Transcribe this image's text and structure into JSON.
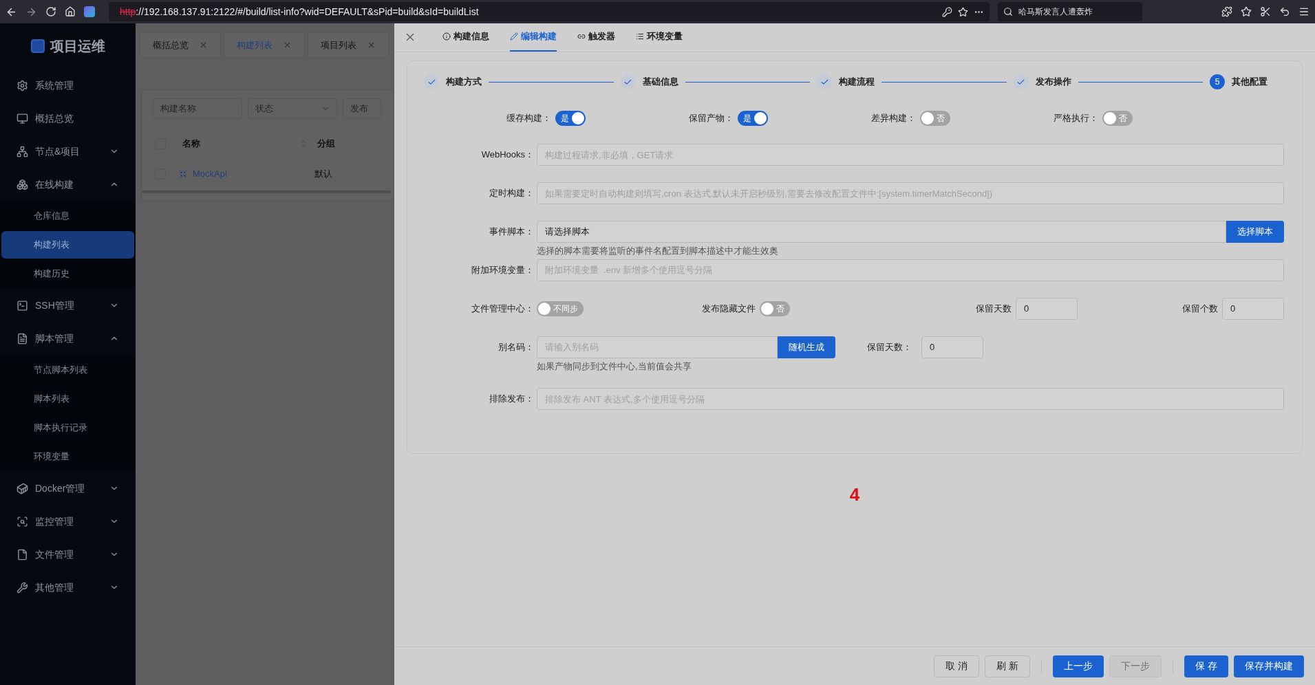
{
  "browser": {
    "url_scheme": "http",
    "url_rest": "://192.168.137.91:2122/#/build/list-info?wid=DEFAULT&sPid=build&sId=buildList",
    "search": "哈马斯发言人遭轰炸"
  },
  "sidebar": {
    "logo": "项目运维",
    "items": [
      {
        "kind": "link",
        "label": "系统管理"
      },
      {
        "kind": "link",
        "label": "概括总览"
      },
      {
        "kind": "group",
        "label": "节点&项目",
        "expanded": false
      },
      {
        "kind": "group",
        "label": "在线构建",
        "expanded": true,
        "children": [
          {
            "label": "仓库信息",
            "selected": false
          },
          {
            "label": "构建列表",
            "selected": true
          },
          {
            "label": "构建历史",
            "selected": false
          }
        ]
      },
      {
        "kind": "group",
        "label": "SSH管理",
        "expanded": false
      },
      {
        "kind": "group",
        "label": "脚本管理",
        "expanded": true,
        "children": [
          {
            "label": "节点脚本列表",
            "selected": false
          },
          {
            "label": "脚本列表",
            "selected": false
          },
          {
            "label": "脚本执行记录",
            "selected": false
          },
          {
            "label": "环境变量",
            "selected": false
          }
        ]
      },
      {
        "kind": "group",
        "label": "Docker管理",
        "expanded": false
      },
      {
        "kind": "group",
        "label": "监控管理",
        "expanded": false
      },
      {
        "kind": "group",
        "label": "文件管理",
        "expanded": false
      },
      {
        "kind": "group",
        "label": "其他管理",
        "expanded": false
      }
    ]
  },
  "page_tabs": [
    {
      "label": "概括总览",
      "selected": false
    },
    {
      "label": "构建列表",
      "selected": true
    },
    {
      "label": "项目列表",
      "selected": false
    }
  ],
  "filters": [
    {
      "placeholder": "构建名称",
      "kind": "input"
    },
    {
      "placeholder": "状态",
      "kind": "select"
    },
    {
      "placeholder": "发布",
      "kind": "input"
    }
  ],
  "table": {
    "all_checked": false,
    "columns": [
      "名称",
      "分组"
    ],
    "rows": [
      {
        "name": "MockApi",
        "group": "默认",
        "checked": false
      }
    ]
  },
  "drawer": {
    "tabs": [
      {
        "label": "构建信息",
        "selected": false
      },
      {
        "label": "编辑构建",
        "selected": true
      },
      {
        "label": "触发器",
        "selected": false
      },
      {
        "label": "环境变量",
        "selected": false
      }
    ],
    "steps": [
      {
        "label": "构建方式",
        "kind": "done"
      },
      {
        "label": "基础信息",
        "kind": "done"
      },
      {
        "label": "构建流程",
        "kind": "done"
      },
      {
        "label": "发布操作",
        "kind": "done"
      },
      {
        "label": "其他配置",
        "kind": "current",
        "number": "5"
      }
    ],
    "switches": [
      {
        "label": "缓存构建：",
        "on": true,
        "text": "是"
      },
      {
        "label": "保留产物：",
        "on": true,
        "text": "是"
      },
      {
        "label": "差异构建：",
        "on": false,
        "text": "否"
      },
      {
        "label": "严格执行：",
        "on": false,
        "text": "否"
      }
    ],
    "webhooks": {
      "label": "WebHooks：",
      "placeholder": "构建过程请求,非必填，GET请求"
    },
    "cron": {
      "label": "定时构建：",
      "placeholder": "如果需要定时自动构建则填写,cron 表达式.默认未开启秒级别,需要去修改配置文件中:[system.timerMatchSecond])"
    },
    "event_script": {
      "label": "事件脚本：",
      "value": "请选择脚本",
      "button": "选择脚本",
      "help": "选择的脚本需要将监听的事件名配置到脚本描述中才能生效奥"
    },
    "env": {
      "label": "附加环境变量：",
      "placeholder": "附加环境变量  .env 新增多个使用逗号分隔"
    },
    "file_center": {
      "label": "文件管理中心：",
      "on": false,
      "text": "不同步"
    },
    "hidden_files": {
      "label": "发布隐藏文件",
      "on": false,
      "text": "否"
    },
    "keep_days": {
      "label": "保留天数",
      "value": "0"
    },
    "keep_count": {
      "label": "保留个数",
      "value": "0"
    },
    "alias": {
      "label": "别名码：",
      "placeholder": "请输入别名码",
      "button": "随机生成",
      "help": "如果产物同步到文件中心,当前值会共享"
    },
    "alias_days": {
      "label": "保留天数：",
      "value": "0"
    },
    "exclude": {
      "label": "排除发布：",
      "placeholder": "排除发布 ANT 表达式,多个使用逗号分隔"
    },
    "annotation": "4",
    "footer": [
      {
        "label": "取 消",
        "kind": "default",
        "disabled": false
      },
      {
        "label": "刷 新",
        "kind": "default",
        "disabled": false
      },
      {
        "label": "上一步",
        "kind": "primary",
        "disabled": false
      },
      {
        "label": "下一步",
        "kind": "primary",
        "disabled": true
      },
      {
        "label": "保 存",
        "kind": "primary",
        "disabled": false
      },
      {
        "label": "保存并构建",
        "kind": "primary",
        "disabled": false
      }
    ]
  }
}
